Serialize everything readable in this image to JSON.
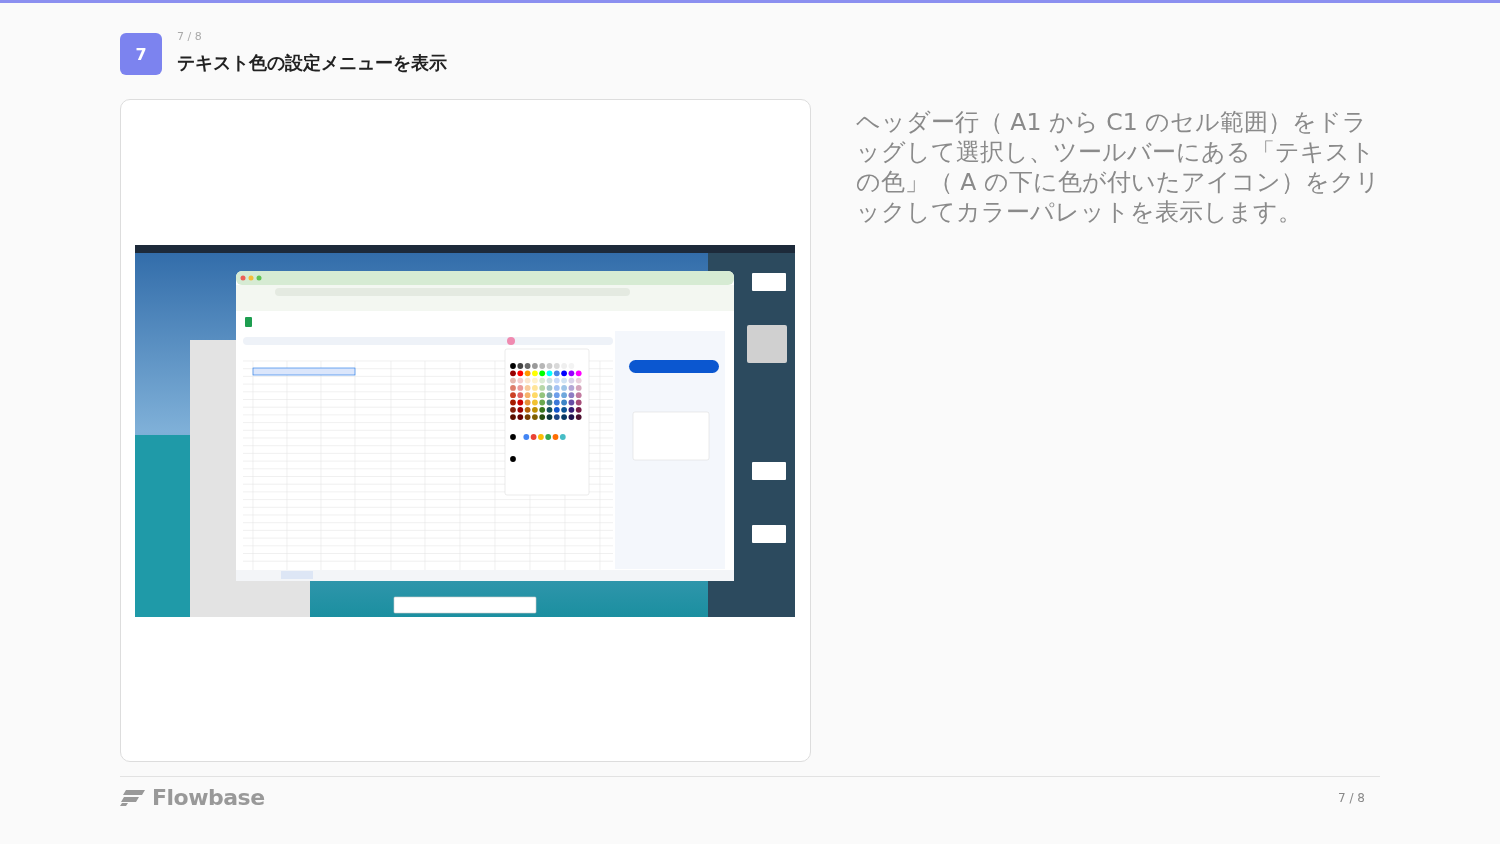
{
  "step": {
    "number": "7",
    "counter": "7 / 8",
    "title": "テキスト色の設定メニューを表示"
  },
  "description": "ヘッダー行（ A1 から C1 のセル範囲）をドラッグして選択し、ツールバーにある「テキストの色」（ A の下に色が付いたアイコン）をクリックしてカラーパレットを表示します。",
  "footer": {
    "brand": "Flowbase",
    "counter": "7 / 8"
  }
}
